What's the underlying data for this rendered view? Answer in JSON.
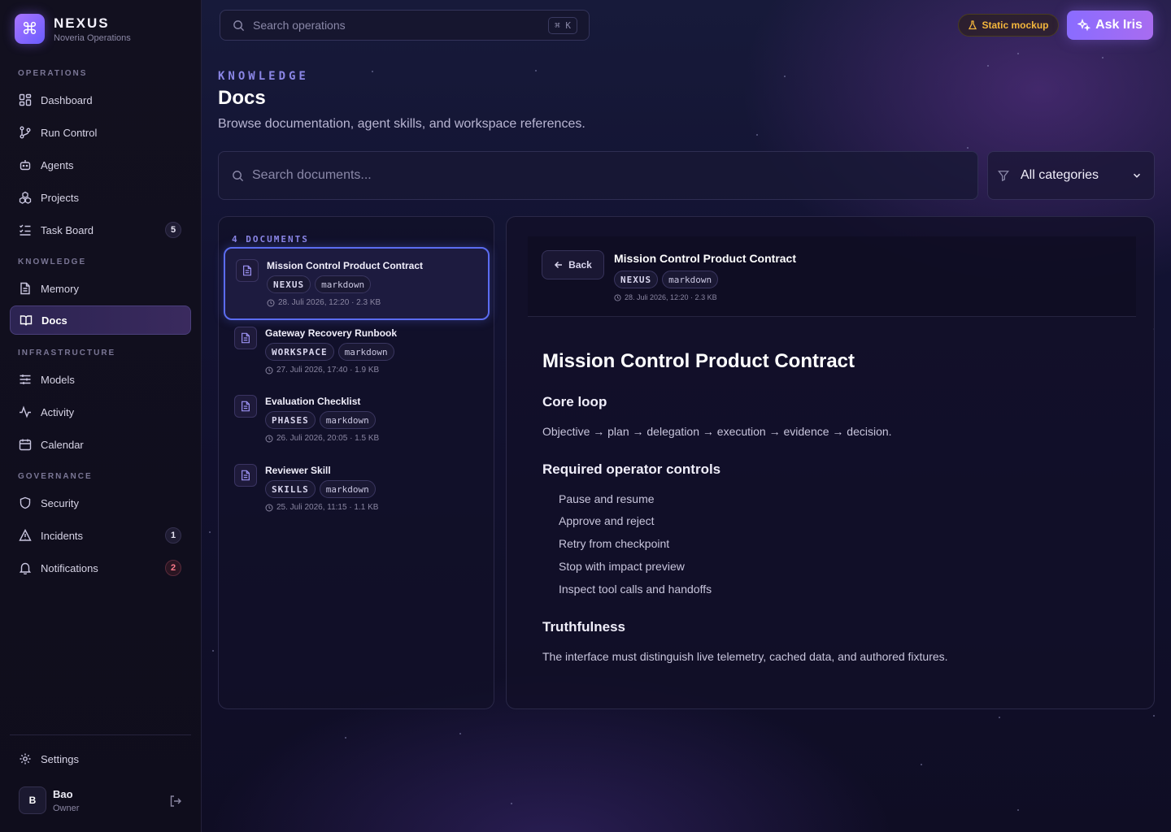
{
  "app": {
    "name": "NEXUS",
    "subtitle": "Noveria Operations"
  },
  "sidebar": {
    "sections": [
      {
        "label": "OPERATIONS",
        "items": [
          {
            "label": "Dashboard",
            "icon": "dashboard-icon"
          },
          {
            "label": "Run Control",
            "icon": "git-branch-icon"
          },
          {
            "label": "Agents",
            "icon": "bot-icon"
          },
          {
            "label": "Projects",
            "icon": "boxes-icon"
          },
          {
            "label": "Task Board",
            "icon": "list-checks-icon",
            "badge": "5"
          }
        ]
      },
      {
        "label": "KNOWLEDGE",
        "items": [
          {
            "label": "Memory",
            "icon": "file-text-icon"
          },
          {
            "label": "Docs",
            "icon": "book-open-icon",
            "active": true
          }
        ]
      },
      {
        "label": "INFRASTRUCTURE",
        "items": [
          {
            "label": "Models",
            "icon": "sliders-icon"
          },
          {
            "label": "Activity",
            "icon": "activity-icon"
          },
          {
            "label": "Calendar",
            "icon": "calendar-icon"
          }
        ]
      },
      {
        "label": "GOVERNANCE",
        "items": [
          {
            "label": "Security",
            "icon": "shield-icon"
          },
          {
            "label": "Incidents",
            "icon": "alert-triangle-icon",
            "badge": "1"
          },
          {
            "label": "Notifications",
            "icon": "bell-icon",
            "badge": "2"
          }
        ]
      }
    ],
    "settings_label": "Settings",
    "user": {
      "initial": "B",
      "name": "Bao",
      "role": "Owner"
    }
  },
  "topbar": {
    "search_placeholder": "Search operations",
    "shortcut": "⌘ K",
    "static_label": "Static mockup",
    "ask_label": "Ask Iris"
  },
  "page": {
    "kicker": "KNOWLEDGE",
    "title": "Docs",
    "subtitle": "Browse documentation, agent skills, and workspace references."
  },
  "filters": {
    "search_placeholder": "Search documents...",
    "category": "All categories"
  },
  "doc_list": {
    "count_label": "4 DOCUMENTS",
    "items": [
      {
        "title": "Mission Control Product Contract",
        "category": "NEXUS",
        "format": "markdown",
        "meta": "28. Juli 2026, 12:20 · 2.3 KB",
        "selected": true
      },
      {
        "title": "Gateway Recovery Runbook",
        "category": "WORKSPACE",
        "format": "markdown",
        "meta": "27. Juli 2026, 17:40 · 1.9 KB"
      },
      {
        "title": "Evaluation Checklist",
        "category": "PHASES",
        "format": "markdown",
        "meta": "26. Juli 2026, 20:05 · 1.5 KB"
      },
      {
        "title": "Reviewer Skill",
        "category": "SKILLS",
        "format": "markdown",
        "meta": "25. Juli 2026, 11:15 · 1.1 KB"
      }
    ]
  },
  "detail": {
    "back_label": "Back",
    "title": "Mission Control Product Contract",
    "category": "NEXUS",
    "format": "markdown",
    "meta": "28. Juli 2026, 12:20 · 2.3 KB",
    "article": {
      "h1": "Mission Control Product Contract",
      "section1_title": "Core loop",
      "section1_text": "Objective → plan → delegation → execution → evidence → decision.",
      "section2_title": "Required operator controls",
      "controls": [
        "Pause and resume",
        "Approve and reject",
        "Retry from checkpoint",
        "Stop with impact preview",
        "Inspect tool calls and handoffs"
      ],
      "section3_title": "Truthfulness",
      "section3_text": "The interface must distinguish live telemetry, cached data, and authored fixtures."
    }
  },
  "colors": {
    "accent": "#8b86e6",
    "brand_gradient_start": "#a874ff",
    "brand_gradient_end": "#6a5cff",
    "warning": "#f3b63c",
    "danger": "#ff7a8a",
    "selection_border": "#5b6cf0"
  }
}
